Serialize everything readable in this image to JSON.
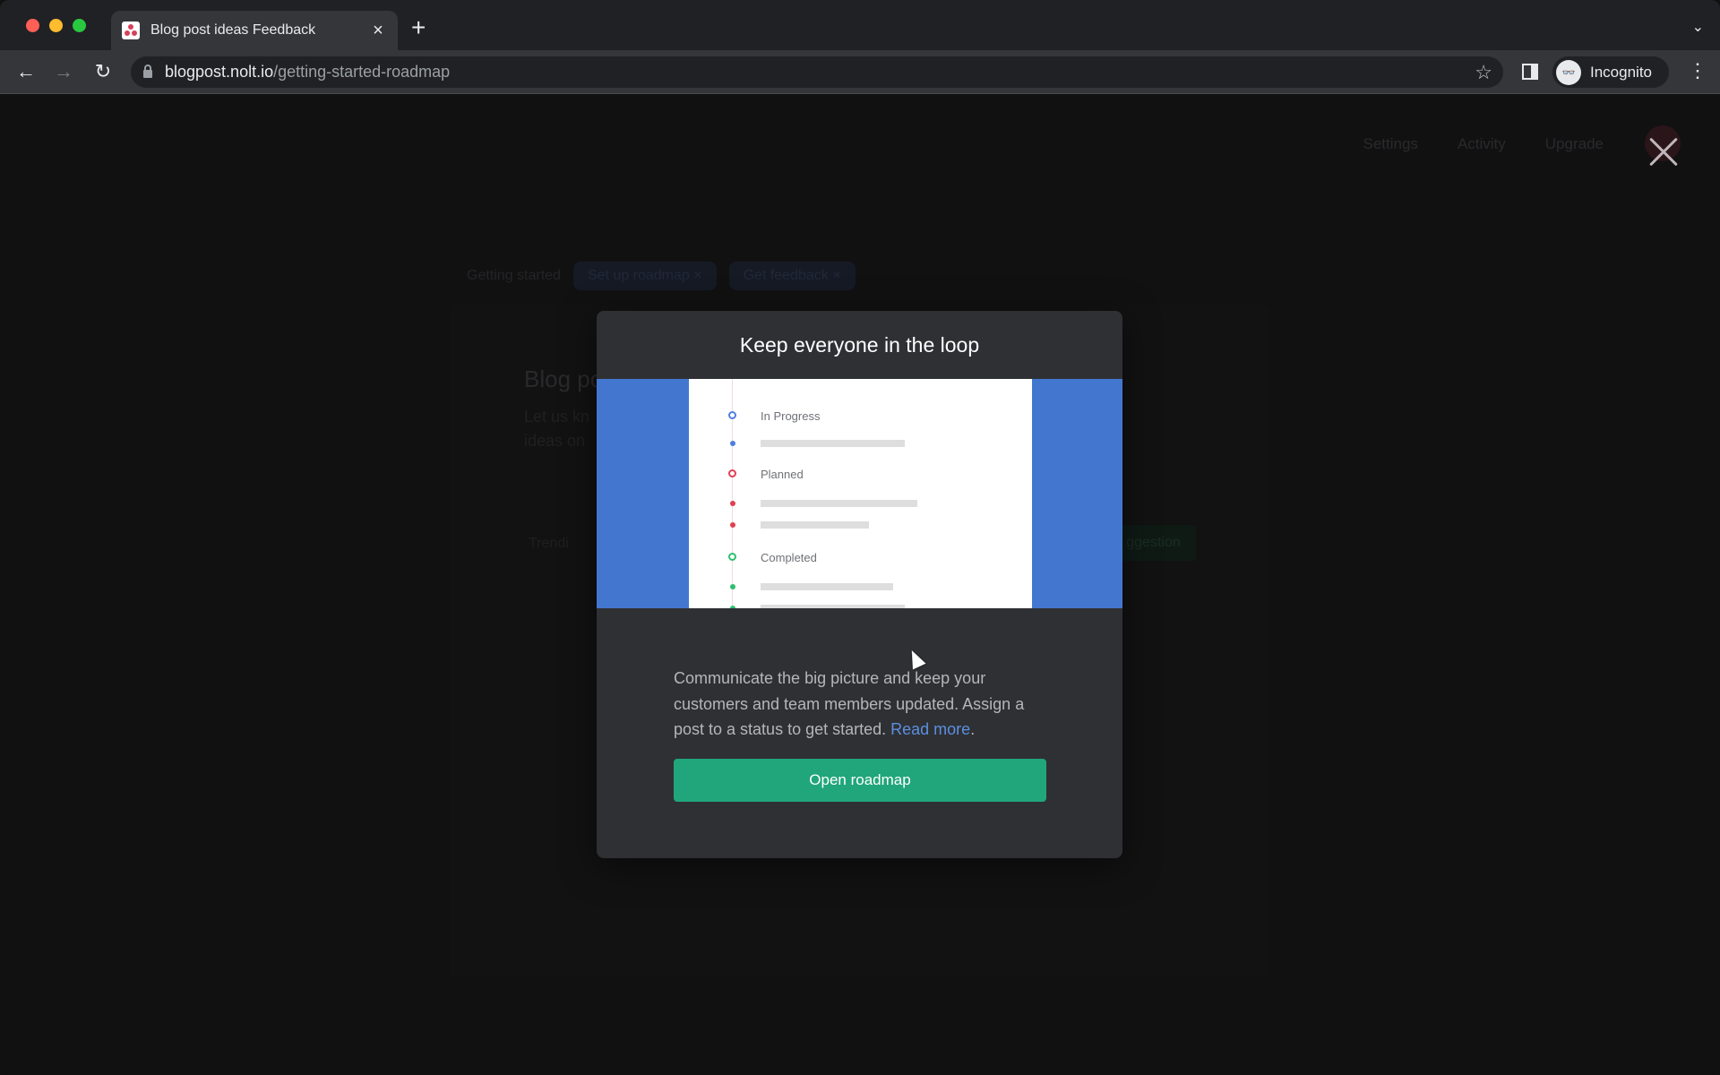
{
  "browser": {
    "tab": {
      "title": "Blog post ideas Feedback",
      "favicon": "nolt-logo-icon",
      "close": "×"
    },
    "new_tab": "+",
    "tab_menu": "⌄",
    "nav": {
      "back": "←",
      "forward": "→",
      "reload": "↻"
    },
    "url": {
      "host": "blogpost.nolt.io",
      "path": "/getting-started-roadmap"
    },
    "bookmark": "☆",
    "profile": {
      "label": "Incognito",
      "icon": "incognito-icon"
    },
    "menu": "⋮"
  },
  "page": {
    "topnav": [
      "Settings",
      "Activity",
      "Upgrade"
    ],
    "close": "close-icon",
    "getting_started": {
      "label": "Getting started",
      "chips": [
        "Set up roadmap ×",
        "Get feedback ×"
      ]
    },
    "board": {
      "title": "Blog po",
      "description": "Let us kn\nideas on",
      "trending": "Trendi",
      "new_button": "ggestion"
    }
  },
  "modal": {
    "title": "Keep everyone in the loop",
    "preview": {
      "sections": [
        {
          "label": "In Progress",
          "color": "#4f7fe0"
        },
        {
          "label": "Planned",
          "color": "#e04050"
        },
        {
          "label": "Completed",
          "color": "#2ebf6e"
        }
      ]
    },
    "body": "Communicate the big picture and keep your customers and team members updated. Assign a post to a status to get started. ",
    "link": "Read more",
    "link_suffix": ".",
    "button": "Open roadmap"
  },
  "colors": {
    "accent_green": "#20a67a",
    "image_blue": "#4377cf",
    "link_blue": "#5b8fe0"
  }
}
